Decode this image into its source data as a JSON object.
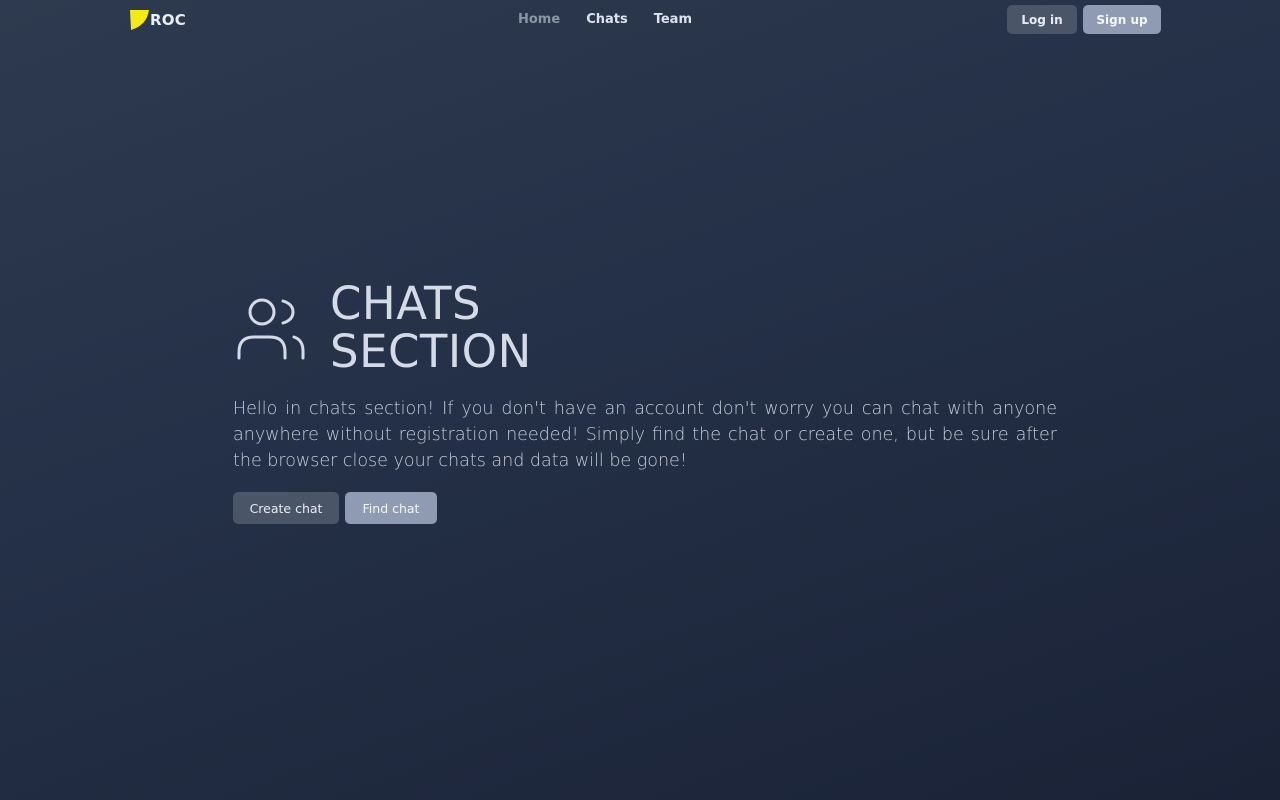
{
  "brand": {
    "name": "ROC",
    "logo_color": "#f5ea14"
  },
  "nav": {
    "links": [
      {
        "label": "Home",
        "state": "muted"
      },
      {
        "label": "Chats",
        "state": "active"
      },
      {
        "label": "Team",
        "state": "active"
      }
    ]
  },
  "auth": {
    "login_label": "Log in",
    "signup_label": "Sign up"
  },
  "hero": {
    "icon": "users-icon",
    "title_line1": "CHATS",
    "title_line2": "SECTION",
    "description": "Hello in chats section! If you don't have an account don't worry you can chat with anyone anywhere without registration needed! Simply find the chat or create one, but be sure after the browser close your chats and data will be gone!",
    "create_label": "Create chat",
    "find_label": "Find chat"
  },
  "colors": {
    "background_top": "#2e3a4f",
    "background_bottom": "#1a2236",
    "button_dark": "#4a5568",
    "button_light": "#8f9bb3"
  }
}
